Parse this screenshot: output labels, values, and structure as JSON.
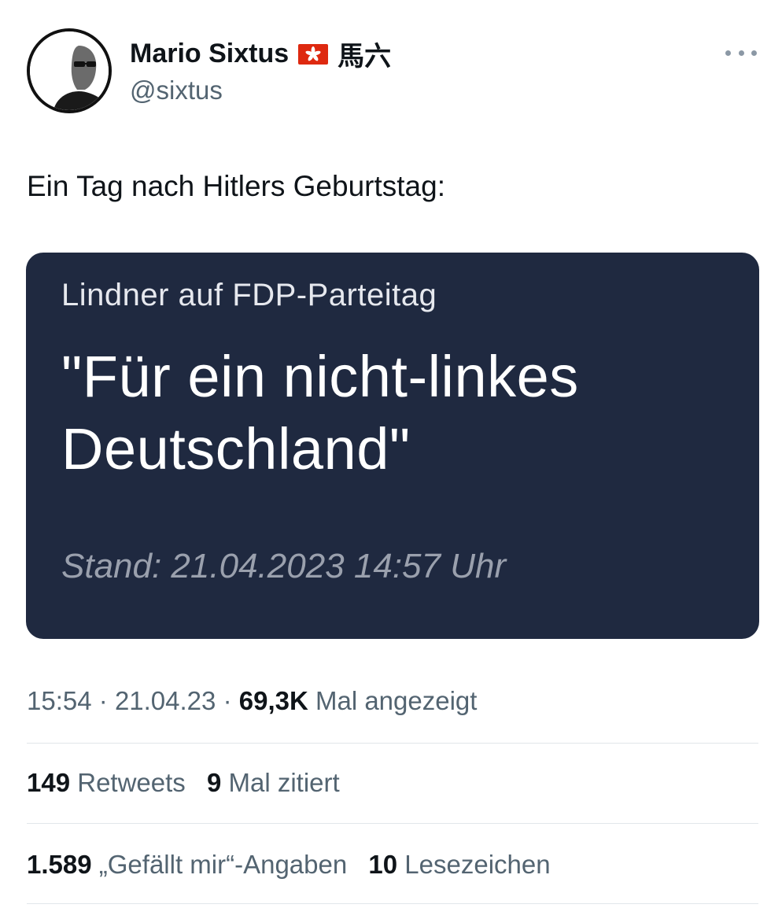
{
  "author": {
    "name": "Mario Sixtus",
    "flag_icon": "hong-kong-flag-icon",
    "name_suffix": "馬六",
    "handle": "@sixtus"
  },
  "tweet": {
    "text": "Ein Tag nach Hitlers Geburtstag:"
  },
  "image_card": {
    "kicker": "Lindner auf FDP-Parteitag",
    "headline_line1": "\"Für ein nicht-linkes",
    "headline_line2": "Deutschland\"",
    "stand": "Stand: 21.04.2023 14:57 Uhr",
    "background_color": "#1f2940"
  },
  "meta": {
    "time": "15:54",
    "separator": "·",
    "date": "21.04.23",
    "views_count": "69,3K",
    "views_label": "Mal angezeigt"
  },
  "stats": {
    "retweets_count": "149",
    "retweets_label": "Retweets",
    "quotes_count": "9",
    "quotes_label": "Mal zitiert",
    "likes_count": "1.589",
    "likes_label": "„Gefällt mir“-Angaben",
    "bookmarks_count": "10",
    "bookmarks_label": "Lesezeichen"
  },
  "colors": {
    "text_primary": "#0f1419",
    "text_secondary": "#536471",
    "divider": "#e1e6ea"
  }
}
